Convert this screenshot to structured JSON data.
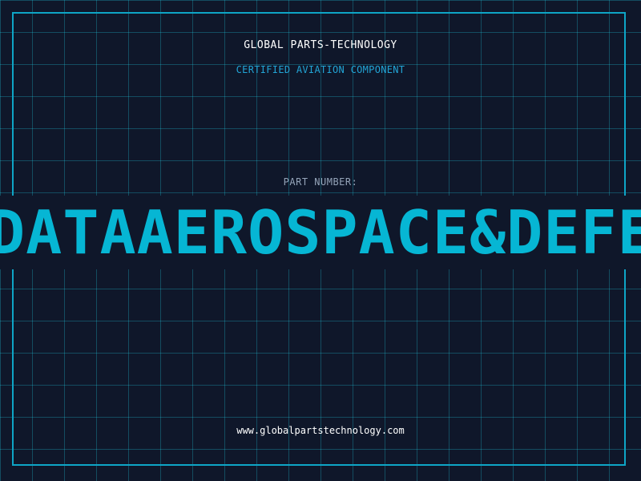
{
  "header": {
    "company": "GLOBAL PARTS-TECHNOLOGY",
    "subtitle": "CERTIFIED AVIATION COMPONENT"
  },
  "part": {
    "label": "PART NUMBER:",
    "value": "DATAAEROSPACE&DEFENSE"
  },
  "footer": {
    "website": "www.globalpartstechnology.com"
  },
  "colors": {
    "background": "#0f172a",
    "grid": "#22d3ee",
    "accent": "#06b6d4",
    "frame": "#0ea5c6"
  }
}
